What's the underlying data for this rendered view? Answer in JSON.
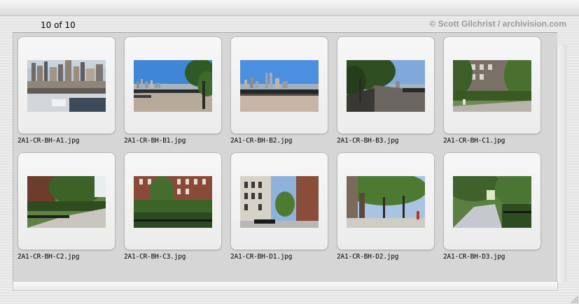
{
  "header": {
    "counter": "10 of 10",
    "copyright": "© Scott Gilchrist / archivision.com"
  },
  "thumbnails": [
    {
      "filename": "2A1-CR-BH-A1.jpg",
      "scene": "skyline-aerial"
    },
    {
      "filename": "2A1-CR-BH-B1.jpg",
      "scene": "promenade-skyline"
    },
    {
      "filename": "2A1-CR-BH-B2.jpg",
      "scene": "promenade-skyline-wide"
    },
    {
      "filename": "2A1-CR-BH-B3.jpg",
      "scene": "promenade-trees"
    },
    {
      "filename": "2A1-CR-BH-C1.jpg",
      "scene": "brownstone-garden"
    },
    {
      "filename": "2A1-CR-BH-C2.jpg",
      "scene": "garden-path"
    },
    {
      "filename": "2A1-CR-BH-C3.jpg",
      "scene": "brick-building-fence"
    },
    {
      "filename": "2A1-CR-BH-D1.jpg",
      "scene": "street-houses"
    },
    {
      "filename": "2A1-CR-BH-D2.jpg",
      "scene": "street-trees"
    },
    {
      "filename": "2A1-CR-BH-D3.jpg",
      "scene": "park-path"
    }
  ]
}
